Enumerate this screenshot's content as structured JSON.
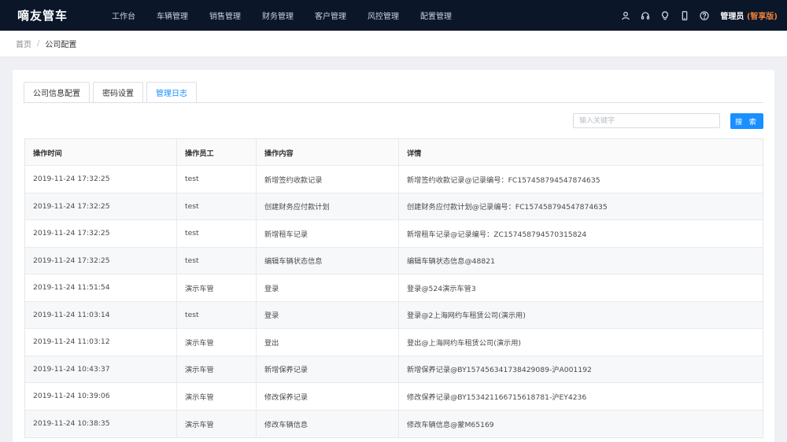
{
  "header": {
    "logo": "嘀友管车",
    "nav": [
      "工作台",
      "车辆管理",
      "销售管理",
      "财务管理",
      "客户管理",
      "风控管理",
      "配置管理"
    ],
    "icons": [
      "user-icon",
      "headset-icon",
      "lightbulb-icon",
      "mobile-icon",
      "help-icon"
    ],
    "user": "管理员",
    "edition": "(智享版)"
  },
  "breadcrumb": {
    "home": "首页",
    "sep": "/",
    "current": "公司配置"
  },
  "tabs": [
    {
      "label": "公司信息配置",
      "active": false
    },
    {
      "label": "密码设置",
      "active": false
    },
    {
      "label": "管理日志",
      "active": true
    }
  ],
  "search": {
    "placeholder": "输入关键字",
    "button": "搜 索"
  },
  "table": {
    "columns": [
      "操作时间",
      "操作员工",
      "操作内容",
      "详情"
    ],
    "rows": [
      [
        "2019-11-24 17:32:25",
        "test",
        "新增签约收款记录",
        "新增签约收款记录@记录编号：FC157458794547874635"
      ],
      [
        "2019-11-24 17:32:25",
        "test",
        "创建财务应付款计划",
        "创建财务应付款计划@记录编号：FC157458794547874635"
      ],
      [
        "2019-11-24 17:32:25",
        "test",
        "新增租车记录",
        "新增租车记录@记录编号：ZC157458794570315824"
      ],
      [
        "2019-11-24 17:32:25",
        "test",
        "编辑车辆状态信息",
        "编辑车辆状态信息@48821"
      ],
      [
        "2019-11-24 11:51:54",
        "演示车管",
        "登录",
        "登录@524演示车管3"
      ],
      [
        "2019-11-24 11:03:14",
        "test",
        "登录",
        "登录@2上海网约车租赁公司(演示用)"
      ],
      [
        "2019-11-24 11:03:12",
        "演示车管",
        "登出",
        "登出@上海网约车租赁公司(演示用)"
      ],
      [
        "2019-11-24 10:43:37",
        "演示车管",
        "新增保养记录",
        "新增保养记录@BY157456341738429089-沪A001192"
      ],
      [
        "2019-11-24 10:39:06",
        "演示车管",
        "修改保养记录",
        "修改保养记录@BY153421166715618781-沪EY4236"
      ],
      [
        "2019-11-24 10:38:35",
        "演示车管",
        "修改车辆信息",
        "修改车辆信息@蒙M65169"
      ]
    ]
  },
  "colors": {
    "topbar": "#0b1629",
    "accent": "#1890ff",
    "edition": "#e8803a"
  }
}
